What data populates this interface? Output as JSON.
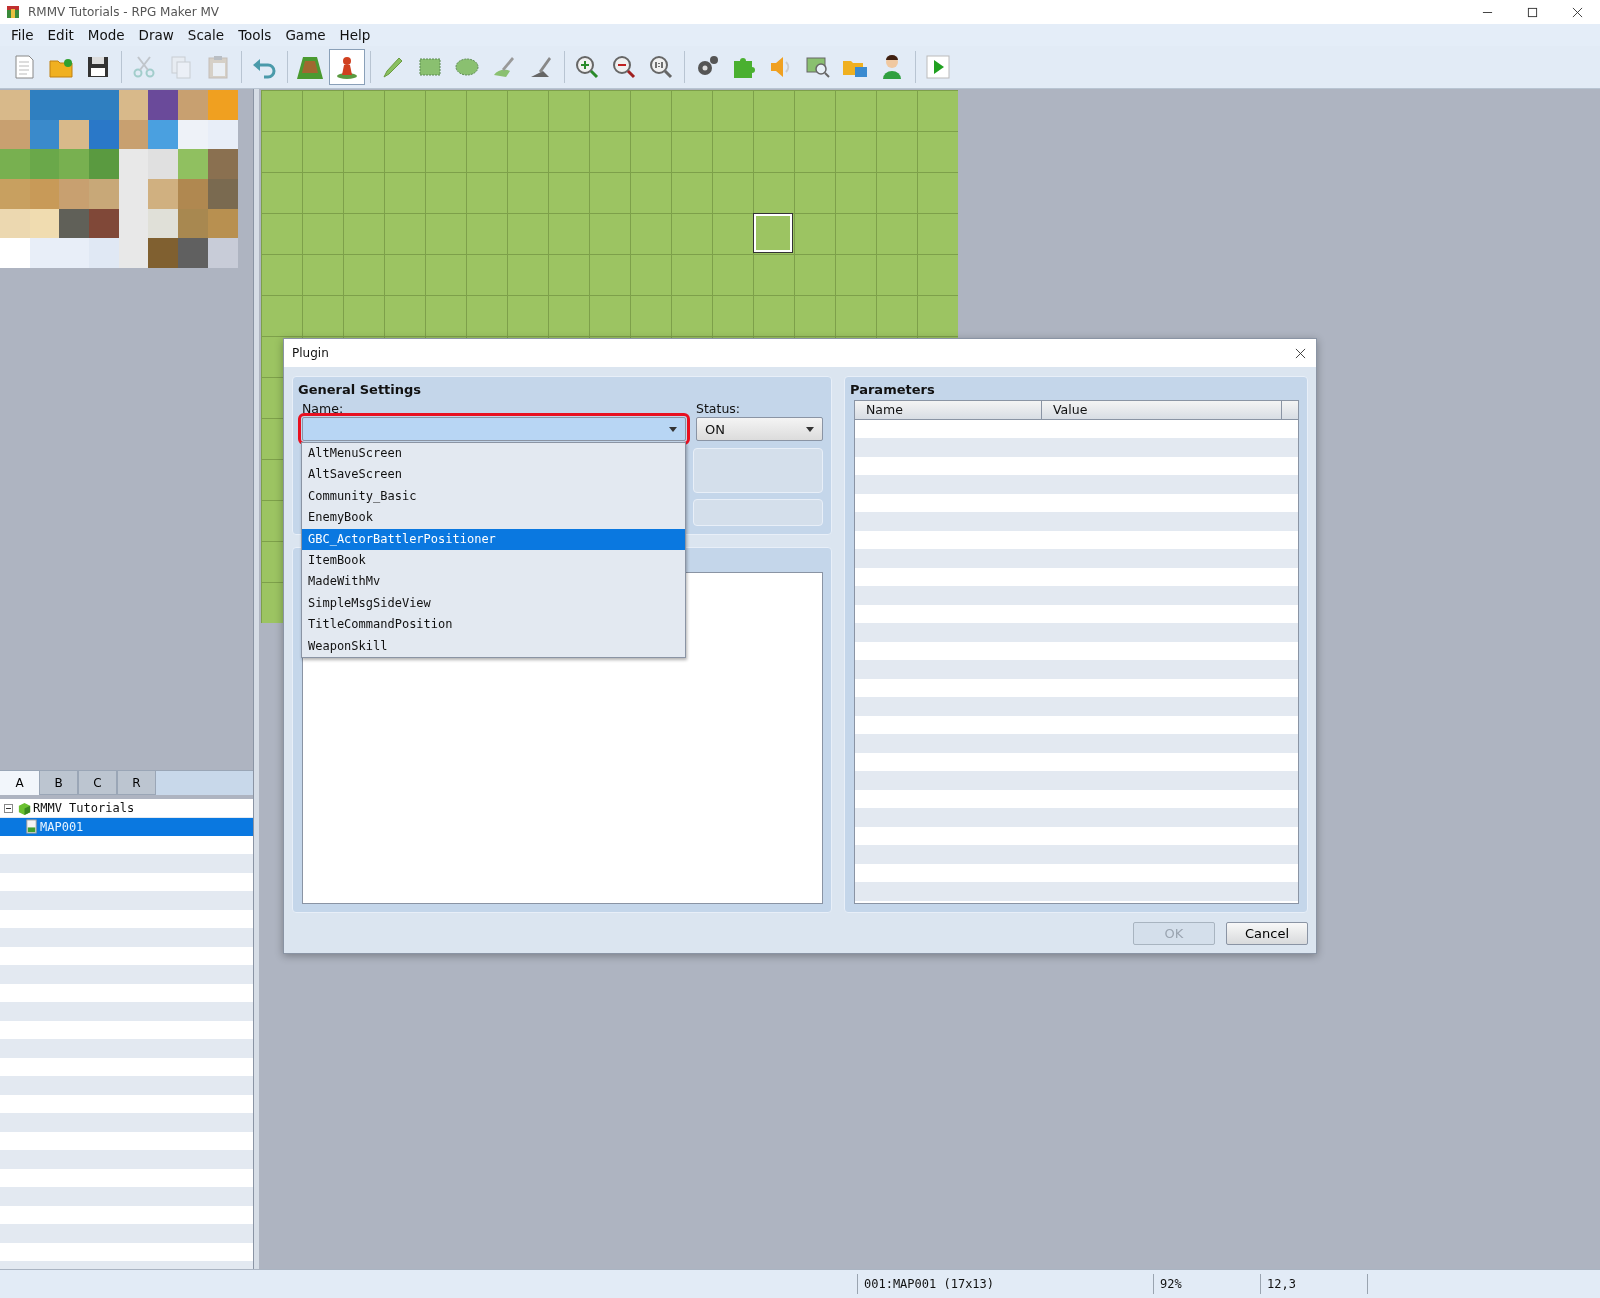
{
  "window": {
    "title": "RMMV Tutorials - RPG Maker MV"
  },
  "menu": [
    "File",
    "Edit",
    "Mode",
    "Draw",
    "Scale",
    "Tools",
    "Game",
    "Help"
  ],
  "toolbar": [
    {
      "kind": "new",
      "disabled": false,
      "selected": false
    },
    {
      "kind": "open",
      "disabled": false,
      "selected": false
    },
    {
      "kind": "save",
      "disabled": false,
      "selected": false
    },
    {
      "kind": "separator"
    },
    {
      "kind": "cut",
      "disabled": true,
      "selected": false
    },
    {
      "kind": "copy",
      "disabled": true,
      "selected": false
    },
    {
      "kind": "paste",
      "disabled": true,
      "selected": false
    },
    {
      "kind": "separator"
    },
    {
      "kind": "undo",
      "disabled": false,
      "selected": false
    },
    {
      "kind": "separator"
    },
    {
      "kind": "map",
      "disabled": false,
      "selected": false
    },
    {
      "kind": "event",
      "disabled": false,
      "selected": true
    },
    {
      "kind": "separator"
    },
    {
      "kind": "pencil",
      "disabled": false,
      "selected": false
    },
    {
      "kind": "rectangle",
      "disabled": false,
      "selected": false
    },
    {
      "kind": "ellipse",
      "disabled": false,
      "selected": false
    },
    {
      "kind": "fill",
      "disabled": false,
      "selected": false
    },
    {
      "kind": "shadow",
      "disabled": false,
      "selected": false
    },
    {
      "kind": "separator"
    },
    {
      "kind": "zoomin",
      "disabled": false,
      "selected": false
    },
    {
      "kind": "zoomout",
      "disabled": false,
      "selected": false
    },
    {
      "kind": "zoomreset",
      "disabled": false,
      "selected": false
    },
    {
      "kind": "separator"
    },
    {
      "kind": "gears",
      "disabled": false,
      "selected": false
    },
    {
      "kind": "puzzle",
      "disabled": false,
      "selected": false
    },
    {
      "kind": "sound",
      "disabled": false,
      "selected": false
    },
    {
      "kind": "search",
      "disabled": false,
      "selected": false
    },
    {
      "kind": "folders",
      "disabled": false,
      "selected": false
    },
    {
      "kind": "person",
      "disabled": false,
      "selected": false
    },
    {
      "kind": "separator"
    },
    {
      "kind": "play",
      "disabled": false,
      "selected": false
    }
  ],
  "tile_tabs": [
    {
      "label": "A",
      "selected": true
    },
    {
      "label": "B",
      "selected": false
    },
    {
      "label": "C",
      "selected": false
    },
    {
      "label": "R",
      "selected": false
    }
  ],
  "map_tree": [
    {
      "label": "RMMV Tutorials",
      "kind": "project",
      "expanded": true,
      "selected": false,
      "children": [
        {
          "label": "MAP001",
          "kind": "map",
          "selected": true
        }
      ]
    }
  ],
  "dialog": {
    "title": "Plugin",
    "general_settings": {
      "heading": "General Settings",
      "name_label": "Name:",
      "name_highlighted": true,
      "status_label": "Status:",
      "status_value": "ON"
    },
    "name_dropdown": [
      {
        "label": "AltMenuScreen",
        "selected": false
      },
      {
        "label": "AltSaveScreen",
        "selected": false
      },
      {
        "label": "Community_Basic",
        "selected": false
      },
      {
        "label": "EnemyBook",
        "selected": false
      },
      {
        "label": "GBC_ActorBattlerPositioner",
        "selected": true
      },
      {
        "label": "ItemBook",
        "selected": false
      },
      {
        "label": "MadeWithMv",
        "selected": false
      },
      {
        "label": "SimpleMsgSideView",
        "selected": false
      },
      {
        "label": "TitleCommandPosition",
        "selected": false
      },
      {
        "label": "WeaponSkill",
        "selected": false
      }
    ],
    "parameters": {
      "heading": "Parameters",
      "columns": [
        "Name",
        "Value"
      ]
    },
    "buttons": [
      {
        "label": "OK",
        "disabled": true
      },
      {
        "label": "Cancel",
        "disabled": false
      }
    ]
  },
  "status_bar": [
    "001:MAP001 (17x13)",
    "92%",
    "12,3"
  ]
}
